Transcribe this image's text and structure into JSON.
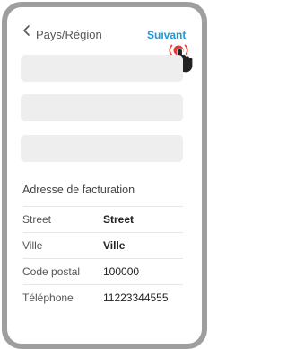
{
  "header": {
    "back_icon": "chevron-left-icon",
    "title": "Pays/Région",
    "next_label": "Suivant",
    "next_color": "#1a9ad6"
  },
  "tap_indicator": {
    "icon": "pointing-hand-icon",
    "ring_color": "#e53935"
  },
  "billing": {
    "section_title": "Adresse de facturation",
    "rows": [
      {
        "label": "Street",
        "value": "Street"
      },
      {
        "label": "Ville",
        "value": "Ville"
      },
      {
        "label": "Code postal",
        "value": "100000"
      },
      {
        "label": "Téléphone",
        "value": "11223344555"
      }
    ]
  }
}
